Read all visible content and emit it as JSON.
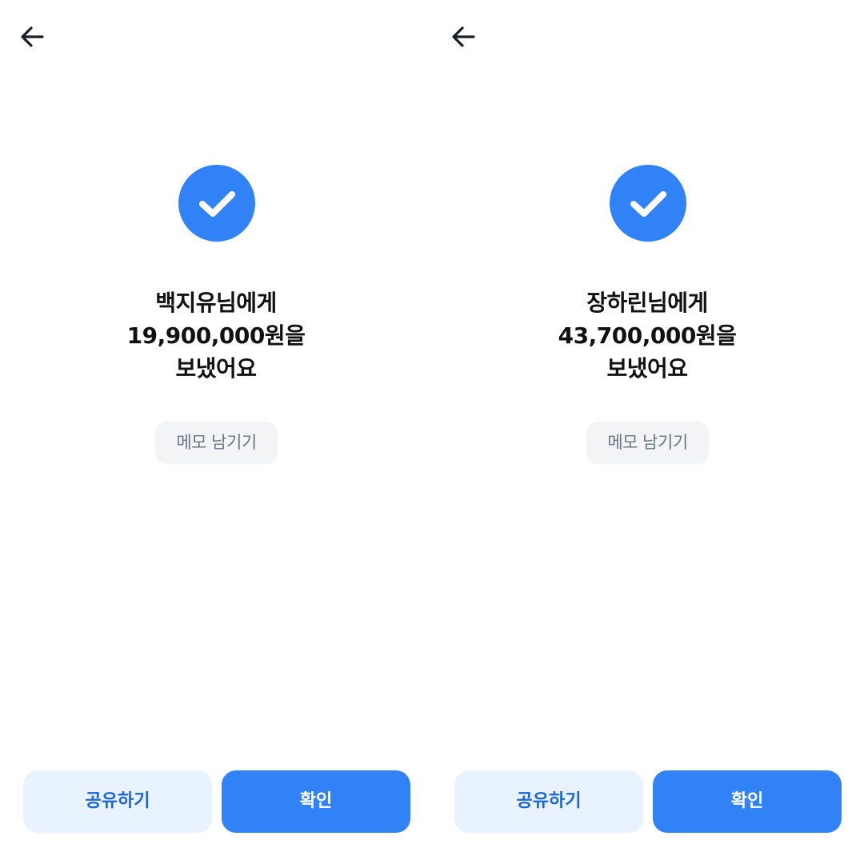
{
  "screens": [
    {
      "recipient_line": "백지유님에게",
      "amount_line": "19,900,000원을",
      "status_line": "보냈어요",
      "memo_label": "메모 남기기",
      "share_label": "공유하기",
      "confirm_label": "확인"
    },
    {
      "recipient_line": "장하린님에게",
      "amount_line": "43,700,000원을",
      "status_line": "보냈어요",
      "memo_label": "메모 남기기",
      "share_label": "공유하기",
      "confirm_label": "확인"
    }
  ],
  "icons": {
    "back": "back-arrow-icon",
    "success": "checkmark-icon"
  },
  "colors": {
    "accent": "#3182f6",
    "share_button_bg": "#e8f3ff",
    "share_button_text": "#1b64da",
    "memo_button_bg": "#f2f4f6",
    "memo_button_text": "#6b7684",
    "title_text": "#111111"
  }
}
